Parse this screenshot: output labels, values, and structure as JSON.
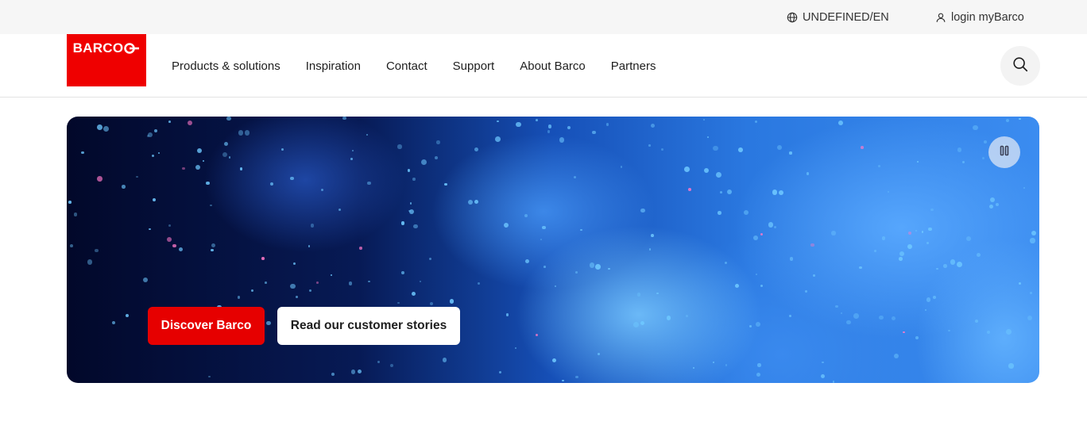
{
  "topbar": {
    "locale": {
      "icon": "globe-icon",
      "label": "UNDEFINED/EN"
    },
    "login": {
      "icon": "user-icon",
      "label": "login myBarco"
    }
  },
  "brand": {
    "logo_text": "BARCO",
    "color": "#ef0000"
  },
  "nav": {
    "items": [
      {
        "label": "Products & solutions"
      },
      {
        "label": "Inspiration"
      },
      {
        "label": "Contact"
      },
      {
        "label": "Support"
      },
      {
        "label": "About Barco"
      },
      {
        "label": "Partners"
      }
    ],
    "search_icon": "search-icon"
  },
  "hero": {
    "pause_icon": "pause-icon",
    "primary_cta": "Discover Barco",
    "secondary_cta": "Read our customer stories",
    "accent_color": "#e60000"
  }
}
